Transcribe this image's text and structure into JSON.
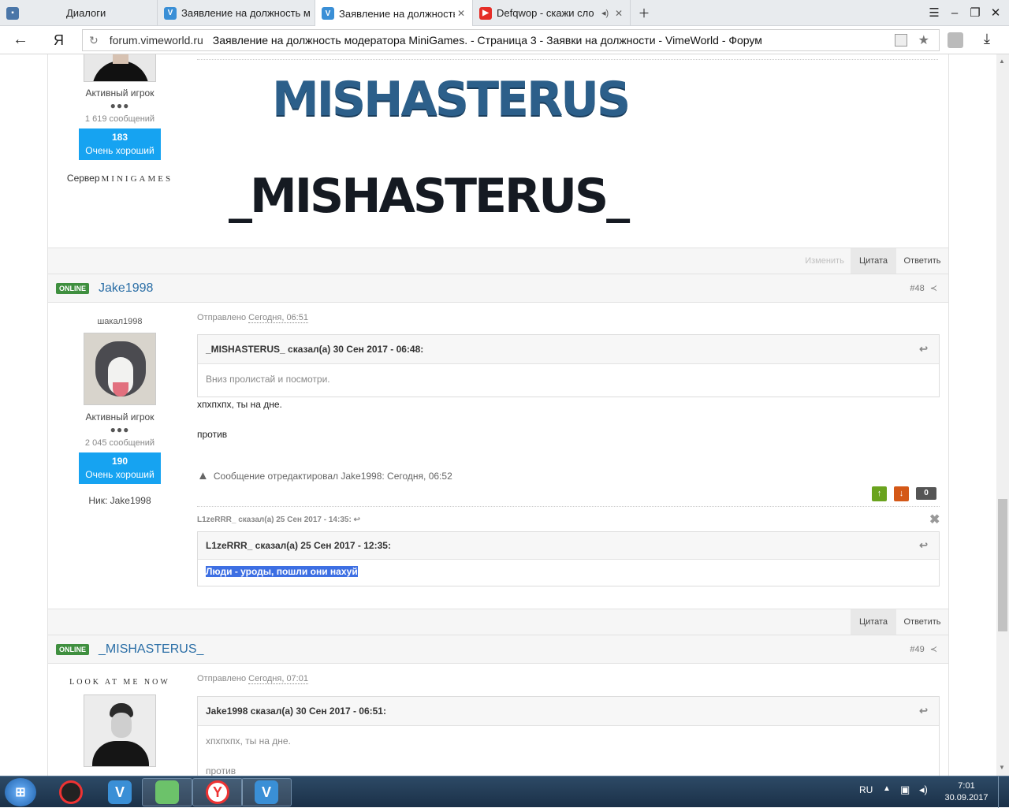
{
  "browser": {
    "tabs": [
      {
        "label": "Диалоги"
      },
      {
        "label": "Заявление на должность м"
      },
      {
        "label": "Заявление на должность"
      },
      {
        "label": "Defqwop - скажи сло"
      }
    ],
    "address": {
      "domain": "forum.vimeworld.ru",
      "title": "Заявление на должность модератора MiniGames. - Страница 3 - Заявки на должности - VimeWorld - Форум"
    },
    "yandex_letter": "Я"
  },
  "post_top": {
    "rank": "Активный игрок",
    "dots": "●●●",
    "messages": "1 619 сообщений",
    "rep_value": "183",
    "rep_label": "Очень хороший",
    "server_prefix": "Сервер",
    "server_name": "MINIGAMES",
    "banner1": "MISHASTERUS",
    "banner2": "_MISHASTERUS_",
    "buttons": {
      "edit": "Изменить",
      "quote": "Цитата",
      "reply": "Ответить"
    }
  },
  "post_48": {
    "status": "ONLINE",
    "author": "Jake1998",
    "num": "#48",
    "title": "шакал1998",
    "rank": "Активный игрок",
    "dots": "●●●",
    "messages": "2 045 сообщений",
    "rep_value": "190",
    "rep_label": "Очень хороший",
    "nick": "Ник: Jake1998",
    "sent_prefix": "Отправлено",
    "sent_time": "Сегодня, 06:51",
    "quote_head": "_MISHASTERUS_ сказал(а) 30 Сен 2017 - 06:48:",
    "quote_body": "Вниз пролистай и посмотри.",
    "line1": "хпхпхпх, ты на дне.",
    "line2": "против",
    "edited": "Сообщение отредактировал Jake1998: Сегодня, 06:52",
    "vote_count": "0",
    "sig_head": "L1zeRRR_ сказал(а) 25 Сен 2017 - 14:35:",
    "sig_quote_head": "L1zeRRR_ сказал(а) 25 Сен 2017 - 12:35:",
    "sig_quote_body": "Люди - уроды, пошли они нахуй",
    "buttons": {
      "quote": "Цитата",
      "reply": "Ответить"
    }
  },
  "post_49": {
    "status": "ONLINE",
    "author": "_MISHASTERUS_",
    "num": "#49",
    "title": "LOOK AT ME NOW",
    "sent_prefix": "Отправлено",
    "sent_time": "Сегодня, 07:01",
    "quote_head": "Jake1998 сказал(а) 30 Сен 2017 - 06:51:",
    "quote_line1": "хпхпхпх, ты на дне.",
    "quote_line2": "против"
  },
  "taskbar": {
    "lang": "RU",
    "time": "7:01",
    "date": "30.09.2017"
  },
  "colors": {
    "accent": "#16a3f1",
    "online": "#3f8f3f",
    "link": "#2a6ea6"
  }
}
